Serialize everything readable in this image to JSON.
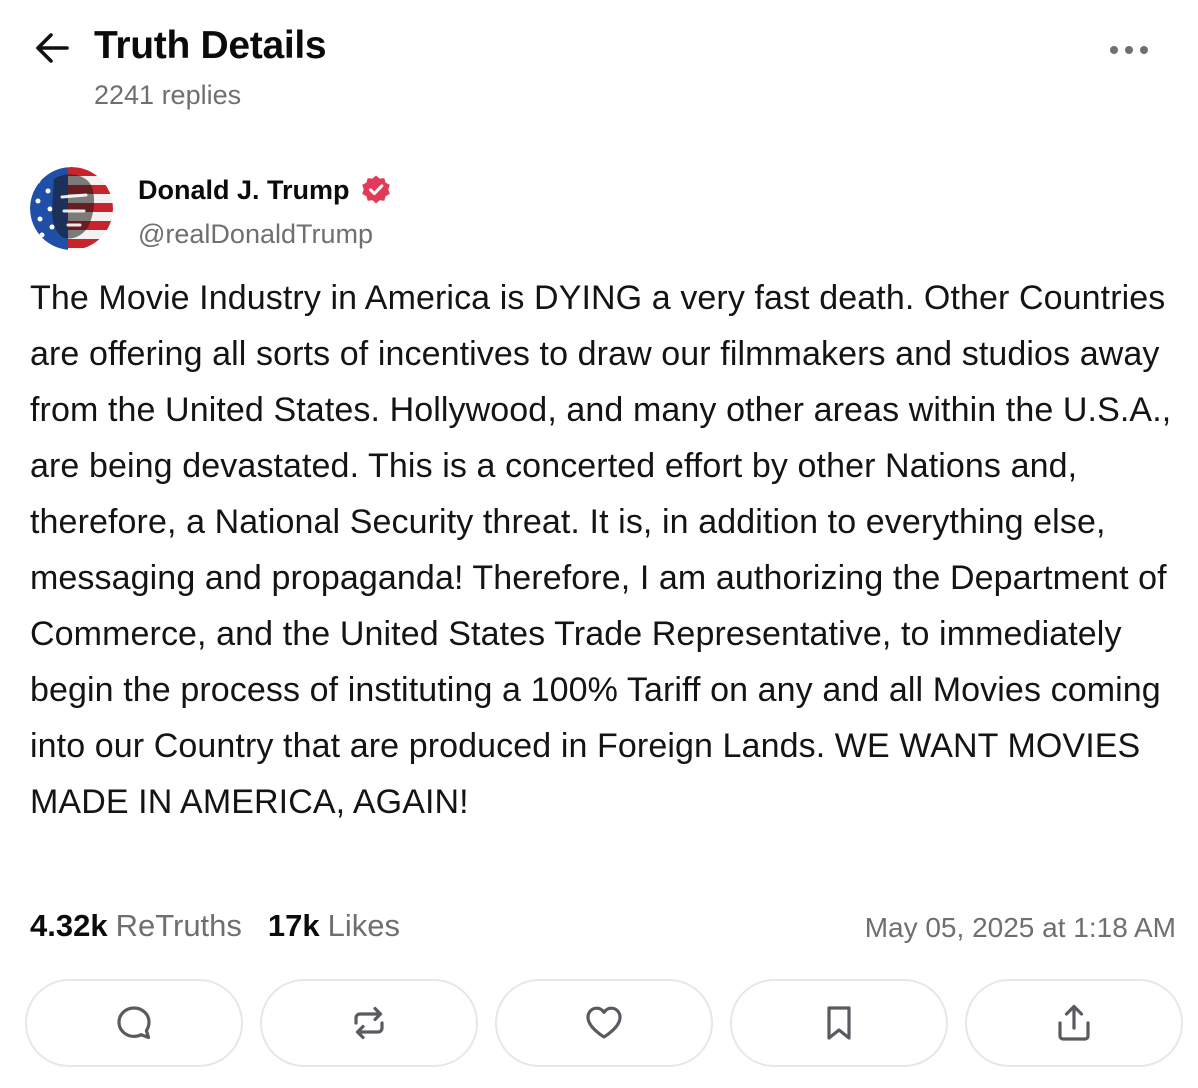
{
  "header": {
    "title": "Truth Details",
    "replies": "2241 replies"
  },
  "post": {
    "author": {
      "name": "Donald J. Trump",
      "handle": "@realDonaldTrump",
      "verified": true,
      "verified_color": "#e23b5a"
    },
    "text": "The Movie Industry in America is DYING a very fast death. Other Countries are offering all sorts of incentives to draw our filmmakers and studios away from the United States. Hollywood, and many other areas within the U.S.A., are being devastated. This is a concerted effort by other Nations and, therefore, a National Security threat. It is, in addition to everything else, messaging and propaganda! Therefore, I am authorizing the Department of Commerce, and the United States Trade Representative, to immediately begin the process of instituting a 100% Tariff on any and all Movies coming into our Country that are produced in Foreign Lands. WE WANT MOVIES MADE IN AMERICA, AGAIN!",
    "stats": {
      "retruths_count": "4.32k",
      "retruths_label": "ReTruths",
      "likes_count": "17k",
      "likes_label": "Likes"
    },
    "timestamp": "May 05, 2025 at 1:18 AM"
  },
  "actions": [
    {
      "icon": "reply-icon"
    },
    {
      "icon": "retruth-icon"
    },
    {
      "icon": "heart-icon"
    },
    {
      "icon": "bookmark-icon"
    },
    {
      "icon": "share-icon"
    }
  ],
  "colors": {
    "muted_text": "#6f6f73",
    "button_border": "#e7e7ea",
    "icon": "#5a5a60"
  }
}
